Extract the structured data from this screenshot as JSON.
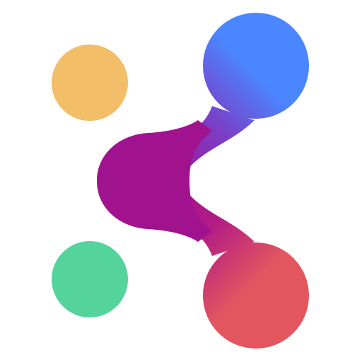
{
  "logo": {
    "icon": "share-network-icon",
    "colors": {
      "yellow_dot": "#F2BE67",
      "green_dot": "#54D39B",
      "blue": "#4A86FF",
      "violet": "#7A3FC8",
      "magenta": "#A1128F",
      "coral": "#E4565F"
    }
  }
}
